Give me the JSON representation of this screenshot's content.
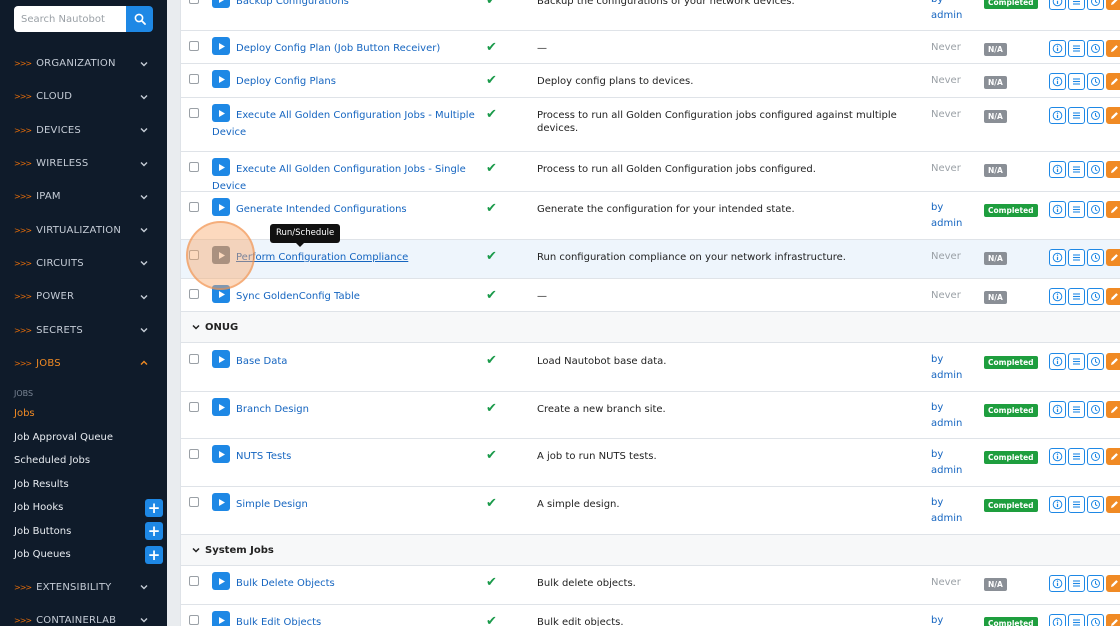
{
  "search": {
    "placeholder": "Search Nautobot"
  },
  "colors": {
    "accent": "#1e88e5",
    "brand_orange": "#f08a24",
    "sidebar_bg": "#0f1b2a",
    "completed": "#1e9e3e",
    "na": "#8a8f96"
  },
  "sidebar": {
    "nav": [
      {
        "label": "ORGANIZATION"
      },
      {
        "label": "CLOUD"
      },
      {
        "label": "DEVICES"
      },
      {
        "label": "WIRELESS"
      },
      {
        "label": "IPAM"
      },
      {
        "label": "VIRTUALIZATION"
      },
      {
        "label": "CIRCUITS"
      },
      {
        "label": "POWER"
      },
      {
        "label": "SECRETS"
      },
      {
        "label": "JOBS",
        "active": true
      }
    ],
    "jobs_heading": "JOBS",
    "jobs_items": [
      {
        "label": "Jobs",
        "active": true
      },
      {
        "label": "Job Approval Queue"
      },
      {
        "label": "Scheduled Jobs"
      },
      {
        "label": "Job Results"
      },
      {
        "label": "Job Hooks",
        "add": true
      },
      {
        "label": "Job Buttons",
        "add": true
      },
      {
        "label": "Job Queues",
        "add": true
      }
    ],
    "nav_after": [
      {
        "label": "EXTENSIBILITY"
      },
      {
        "label": "CONTAINERLAB"
      }
    ]
  },
  "tooltip": "Run/Schedule",
  "labels": {
    "by": "by",
    "admin": "admin"
  },
  "groups": [
    {
      "name": "ONUG"
    },
    {
      "name": "System Jobs"
    }
  ],
  "jobs": [
    {
      "name": "Backup Configurations",
      "description": "Backup the configurations of your network devices.",
      "last_run": "by admin",
      "status": "Completed"
    },
    {
      "name": "Deploy Config Plan (Job Button Receiver)",
      "description": "—",
      "last_run": "Never",
      "status": "N/A"
    },
    {
      "name": "Deploy Config Plans",
      "description": "Deploy config plans to devices.",
      "last_run": "Never",
      "status": "N/A"
    },
    {
      "name": "Execute All Golden Configuration Jobs - Multiple Device",
      "description": "Process to run all Golden Configuration jobs configured against multiple devices.",
      "last_run": "Never",
      "status": "N/A"
    },
    {
      "name": "Execute All Golden Configuration Jobs - Single Device",
      "description": "Process to run all Golden Configuration jobs configured.",
      "last_run": "Never",
      "status": "N/A"
    },
    {
      "name": "Generate Intended Configurations",
      "description": "Generate the configuration for your intended state.",
      "last_run": "by admin",
      "status": "Completed"
    },
    {
      "name": "Perform Configuration Compliance",
      "description": "Run configuration compliance on your network infrastructure.",
      "last_run": "Never",
      "status": "N/A"
    },
    {
      "name": "Sync GoldenConfig Table",
      "description": "—",
      "last_run": "Never",
      "status": "N/A"
    },
    {
      "name": "Base Data",
      "description": "Load Nautobot base data.",
      "last_run": "by admin",
      "status": "Completed"
    },
    {
      "name": "Branch Design",
      "description": "Create a new branch site.",
      "last_run": "by admin",
      "status": "Completed"
    },
    {
      "name": "NUTS Tests",
      "description": "A job to run NUTS tests.",
      "last_run": "by admin",
      "status": "Completed"
    },
    {
      "name": "Simple Design",
      "description": "A simple design.",
      "last_run": "by admin",
      "status": "Completed"
    },
    {
      "name": "Bulk Delete Objects",
      "description": "Bulk delete objects.",
      "last_run": "Never",
      "status": "N/A"
    },
    {
      "name": "Bulk Edit Objects",
      "description": "Bulk edit objects.",
      "last_run": "by admin",
      "status": "Completed"
    }
  ]
}
